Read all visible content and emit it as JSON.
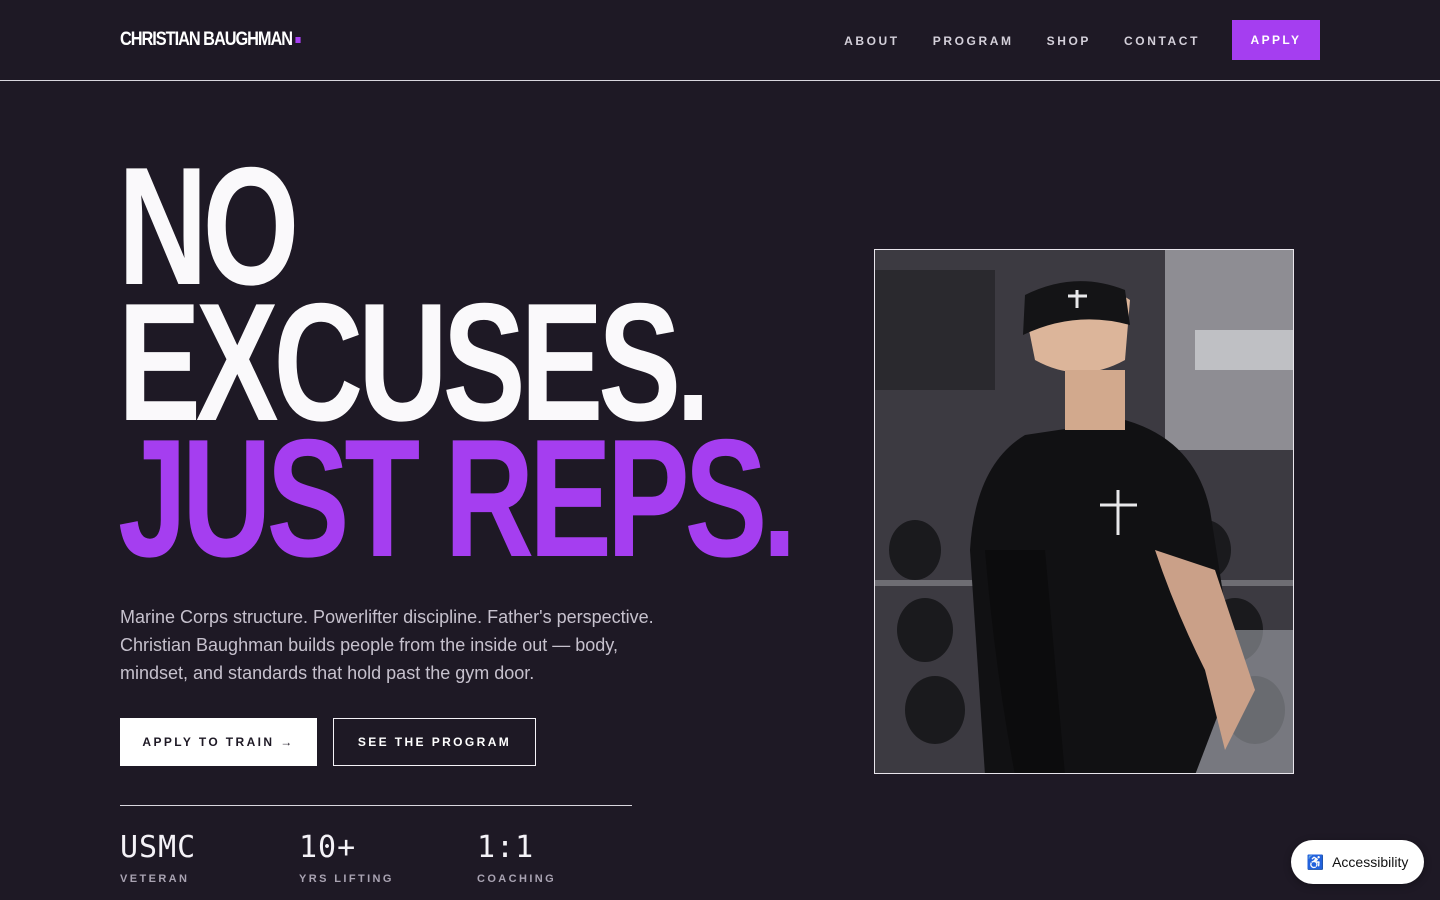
{
  "nav": {
    "logo": "CHRISTIAN BAUGHMAN",
    "links": [
      "ABOUT",
      "PROGRAM",
      "SHOP",
      "CONTACT"
    ],
    "apply": "APPLY"
  },
  "hero": {
    "line1": "NO",
    "line2": "EXCUSES.",
    "line3": "JUST REPS.",
    "subtitle": "Marine Corps structure. Powerlifter discipline. Father's perspective. Christian Baughman builds people from the inside out — body, mindset, and standards that hold past the gym door.",
    "cta_primary": "APPLY TO TRAIN →",
    "cta_secondary": "SEE THE PROGRAM"
  },
  "stats": [
    {
      "value": "USMC",
      "label": "VETERAN"
    },
    {
      "value": "10+",
      "label": "YRS LIFTING"
    },
    {
      "value": "1:1",
      "label": "COACHING"
    }
  ],
  "accessibility": {
    "label": "Accessibility",
    "icon": "accessibility-icon"
  },
  "colors": {
    "accent": "#a53ef0",
    "background": "#1e1925"
  }
}
